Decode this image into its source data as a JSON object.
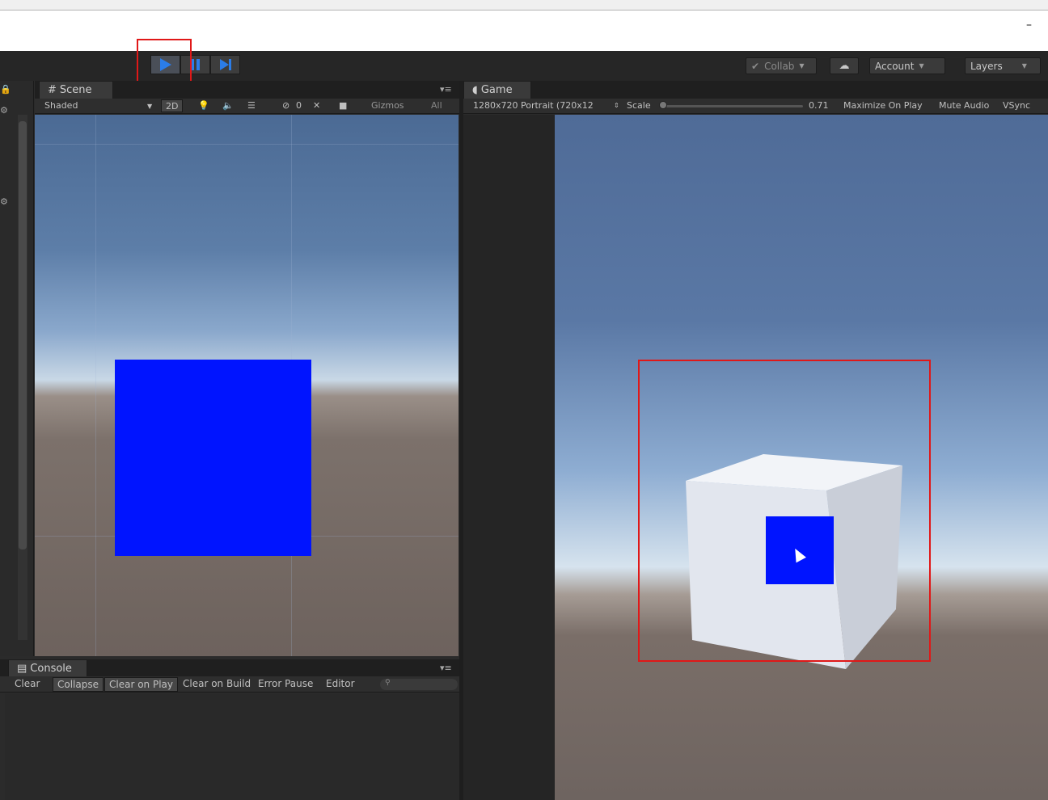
{
  "window": {
    "minimize_glyph": "–"
  },
  "toolbar": {
    "collab": "Collab",
    "account": "Account",
    "layers": "Layers"
  },
  "scene": {
    "tab_label": "Scene",
    "shading": "Shaded",
    "mode_2d": "2D",
    "audio_count": "0",
    "gizmos": "Gizmos",
    "search_placeholder": "All"
  },
  "game": {
    "tab_label": "Game",
    "resolution": "1280x720 Portrait (720x12",
    "scale_label": "Scale",
    "scale_value": "0.71",
    "scale_fraction": 0.0,
    "maximize_on_play": "Maximize On Play",
    "mute_audio": "Mute Audio",
    "vsync": "VSync"
  },
  "console": {
    "tab_label": "Console",
    "buttons": [
      "Clear",
      "Collapse",
      "Clear on Play",
      "Clear on Build",
      "Error Pause",
      "Editor"
    ]
  },
  "colors": {
    "accent_play": "#2b7de9",
    "highlight_box": "#e01818",
    "blue_object": "#0014ff"
  }
}
